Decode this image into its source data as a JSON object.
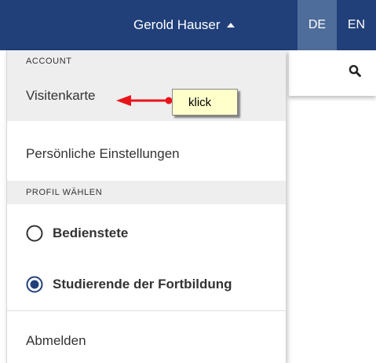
{
  "header": {
    "user_name": "Gerold Hauser",
    "languages": [
      "DE",
      "EN"
    ],
    "active_language": "DE",
    "colors": {
      "bar": "#21407a",
      "active_lang": "#4f6d9a"
    }
  },
  "toolbar": {
    "search_icon": "search-icon"
  },
  "dropdown": {
    "account_header": "ACCOUNT",
    "visitenkarte": "Visitenkarte",
    "einstellungen": "Persönliche Einstellungen",
    "profil_header": "PROFIL WÄHLEN",
    "profiles": [
      {
        "label": "Bedienstete",
        "selected": false
      },
      {
        "label": "Studierende der Fortbildung",
        "selected": true
      }
    ],
    "abmelden": "Abmelden"
  },
  "annotation": {
    "label": "klick",
    "color": "#e8141a"
  }
}
